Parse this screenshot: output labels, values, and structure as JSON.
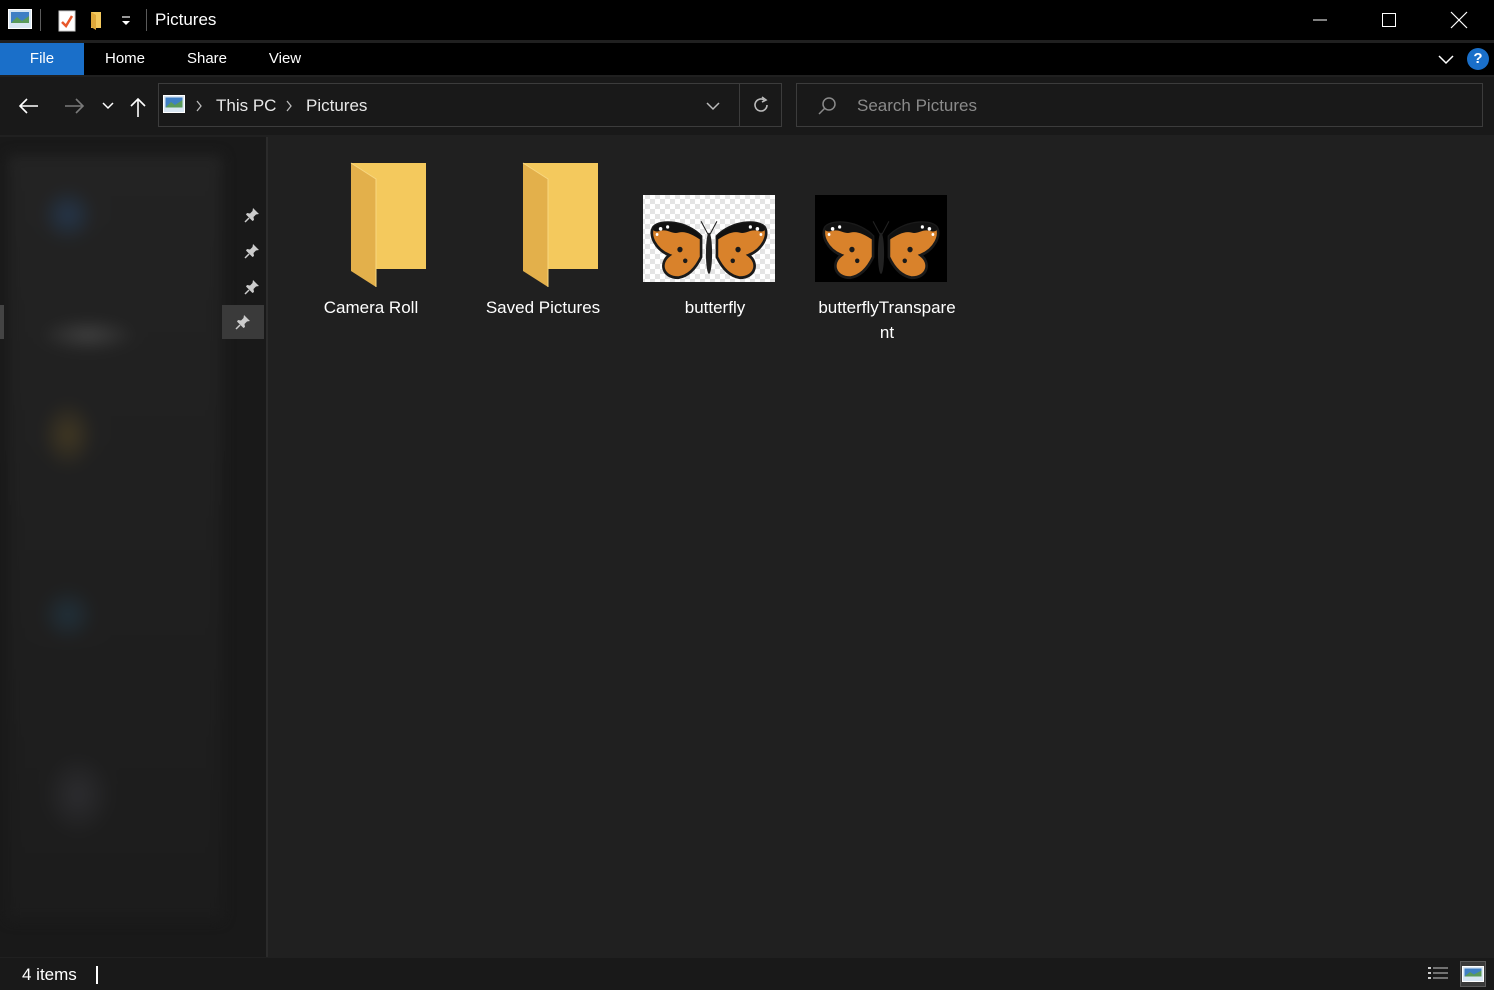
{
  "window": {
    "title": "Pictures",
    "minimize_icon": "minimize-icon",
    "maximize_icon": "maximize-icon",
    "close_icon": "close-icon"
  },
  "quick_access_toolbar": {
    "icons": [
      "pictures-app-icon",
      "properties-icon",
      "new-folder-icon",
      "customize-dropdown-icon"
    ]
  },
  "ribbon": {
    "tabs": [
      {
        "label": "File",
        "active": true
      },
      {
        "label": "Home"
      },
      {
        "label": "Share"
      },
      {
        "label": "View"
      }
    ],
    "accent_color": "#1a6fc9",
    "help_label": "?"
  },
  "navigation": {
    "back_icon": "back-arrow-icon",
    "forward_icon": "forward-arrow-icon",
    "recent_icon": "chevron-down-icon",
    "up_icon": "up-arrow-icon"
  },
  "address_bar": {
    "location_icon": "pictures-location-icon",
    "breadcrumbs": [
      "This PC",
      "Pictures"
    ],
    "refresh_icon": "refresh-icon"
  },
  "search": {
    "placeholder": "Search Pictures",
    "icon": "search-icon"
  },
  "nav_pane": {
    "pins": [
      "pin-icon",
      "pin-icon",
      "pin-icon",
      "pin-icon"
    ],
    "blurred": true
  },
  "content": {
    "items": [
      {
        "name": "Camera Roll",
        "type": "folder"
      },
      {
        "name": "Saved Pictures",
        "type": "folder"
      },
      {
        "name": "butterfly",
        "type": "image",
        "background": "checkerboard"
      },
      {
        "name": "butterflyTransparent",
        "type": "image",
        "background": "black"
      }
    ]
  },
  "status_bar": {
    "item_count": "4 items",
    "details_view_icon": "details-view-icon",
    "large_icons_view_icon": "large-icons-view-icon"
  },
  "colors": {
    "background": "#202020",
    "titlebar": "#000000",
    "folder": "#f4c95d"
  }
}
